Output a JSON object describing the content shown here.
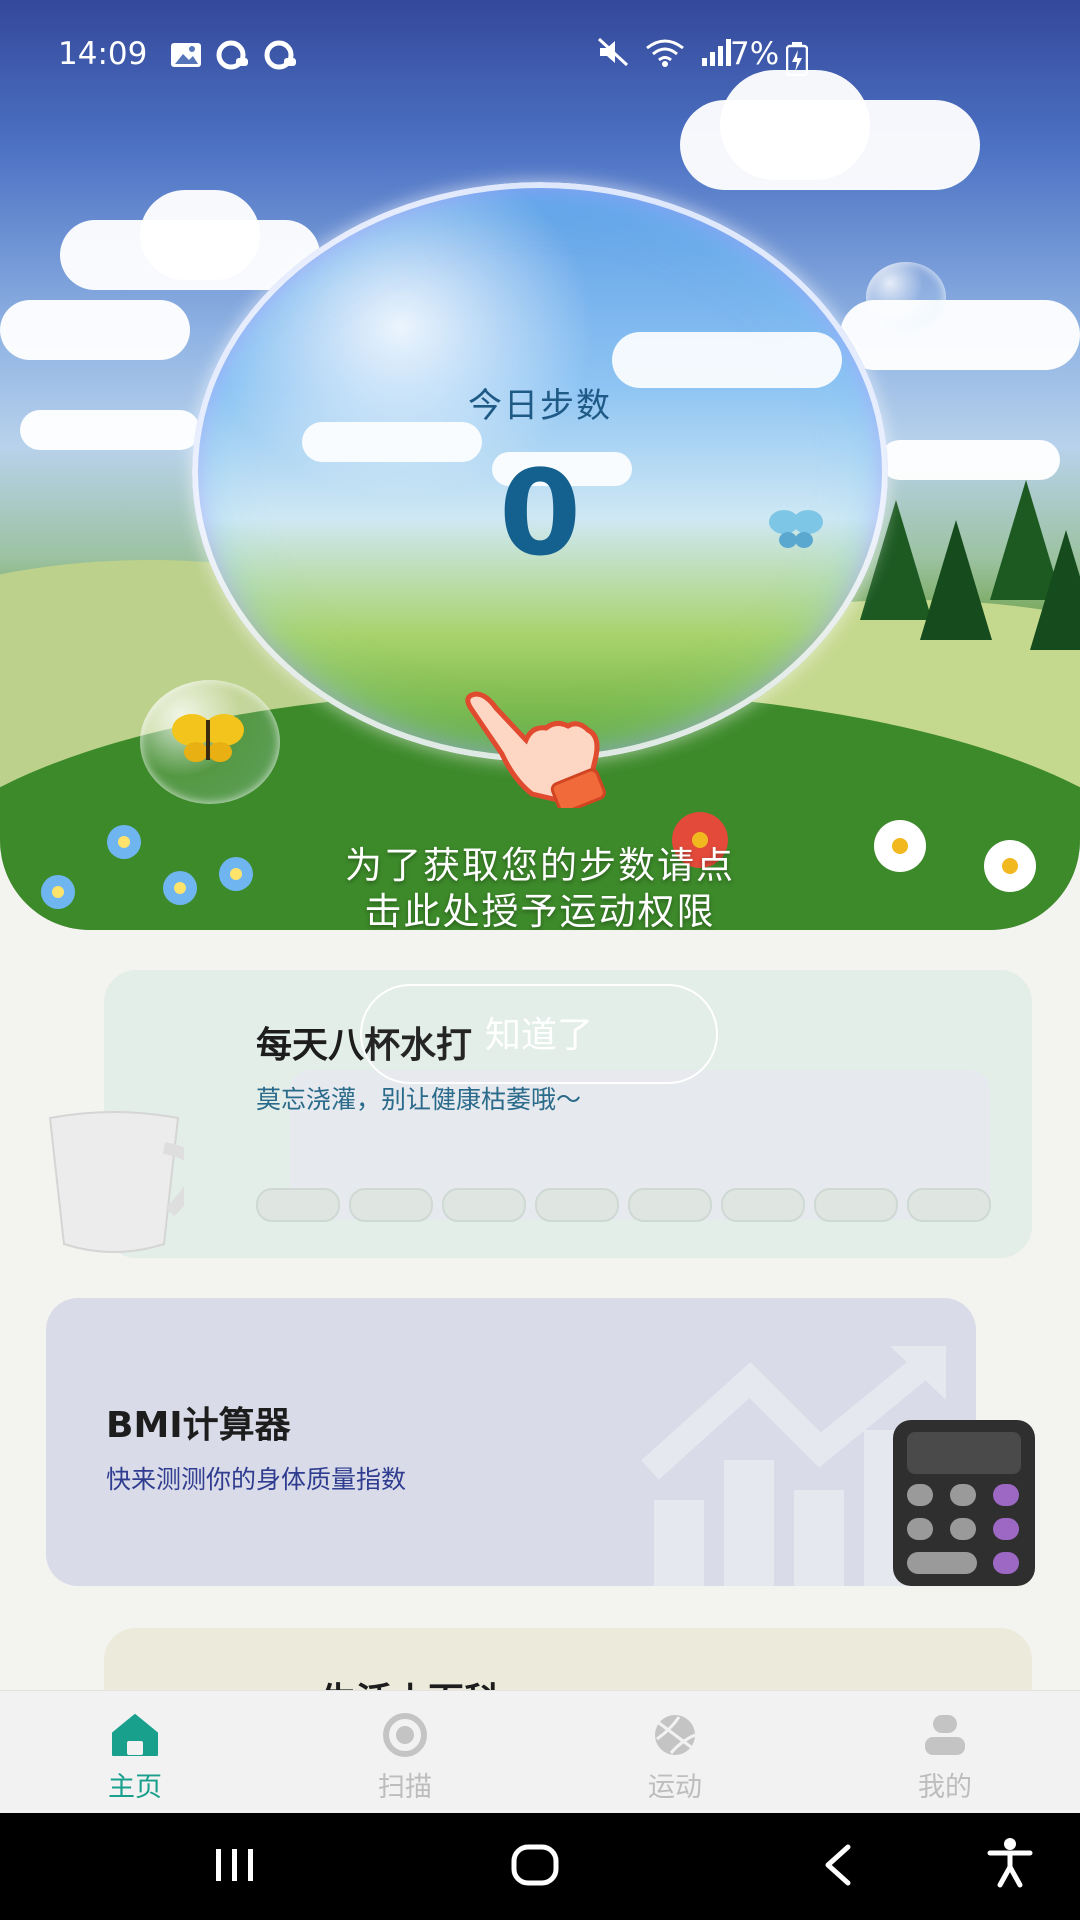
{
  "status_bar": {
    "time": "14:09",
    "battery": "7%",
    "icons": [
      "image-icon",
      "q-app-icon",
      "q-app-icon",
      "mute-icon",
      "wifi-icon",
      "signal-icon",
      "battery-charging-icon"
    ]
  },
  "steps": {
    "label": "今日步数",
    "value": "0",
    "permission_prompt_line1": "为了获取您的步数请点",
    "permission_prompt_line2": "击此处授予运动权限",
    "ack_button": "知道了"
  },
  "water_card": {
    "title": "每天八杯水打",
    "subtitle": "莫忘浇灌，别让健康枯萎哦～",
    "cups_total": 8
  },
  "bmi_card": {
    "title": "BMI计算器",
    "subtitle": "快来测测你的身体质量指数"
  },
  "life_card": {
    "title": "生活小百科"
  },
  "tabs": [
    {
      "label": "主页",
      "icon": "home-icon",
      "active": true
    },
    {
      "label": "扫描",
      "icon": "scan-icon",
      "active": false
    },
    {
      "label": "运动",
      "icon": "sport-ball-icon",
      "active": false
    },
    {
      "label": "我的",
      "icon": "user-icon",
      "active": false
    }
  ],
  "colors": {
    "accent": "#19a08d",
    "inactive_tab": "#bdbdbd",
    "bmi_subtitle": "#2f3c8f",
    "water_subtitle": "#2a6a8a"
  }
}
